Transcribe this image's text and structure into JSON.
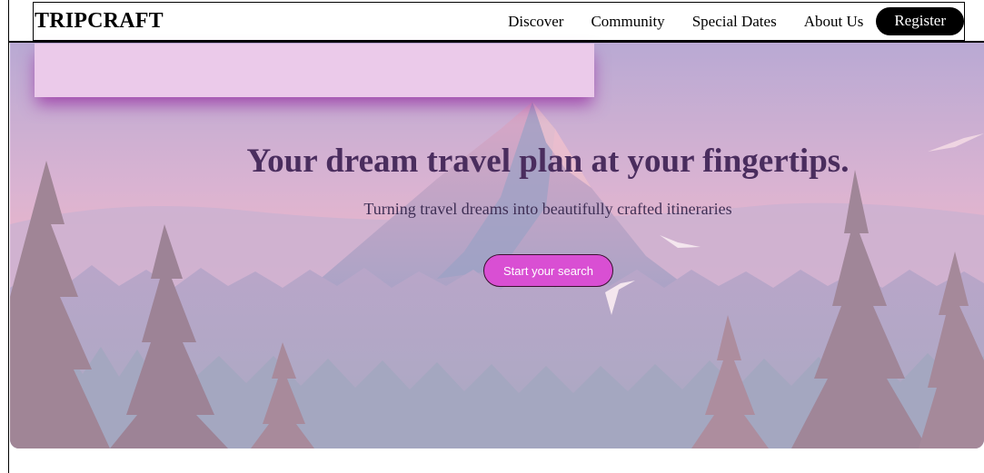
{
  "header": {
    "brand": "TRIPCRAFT",
    "nav": [
      {
        "label": "Discover"
      },
      {
        "label": "Community"
      },
      {
        "label": "Special Dates"
      },
      {
        "label": "About Us"
      }
    ],
    "register_label": "Register"
  },
  "hero": {
    "title": "Your dream travel plan at your fingertips.",
    "subtitle": "Turning travel dreams into beautifully crafted itineraries",
    "cta_label": "Start your search",
    "background": "mountain-forest-illustration",
    "colors": {
      "title": "#4a2d5e",
      "cta": "#d94fd3",
      "overlay": "#ebcaea",
      "sky_top": "#b9a7d4",
      "sky_bottom": "#f2b6c4"
    }
  }
}
